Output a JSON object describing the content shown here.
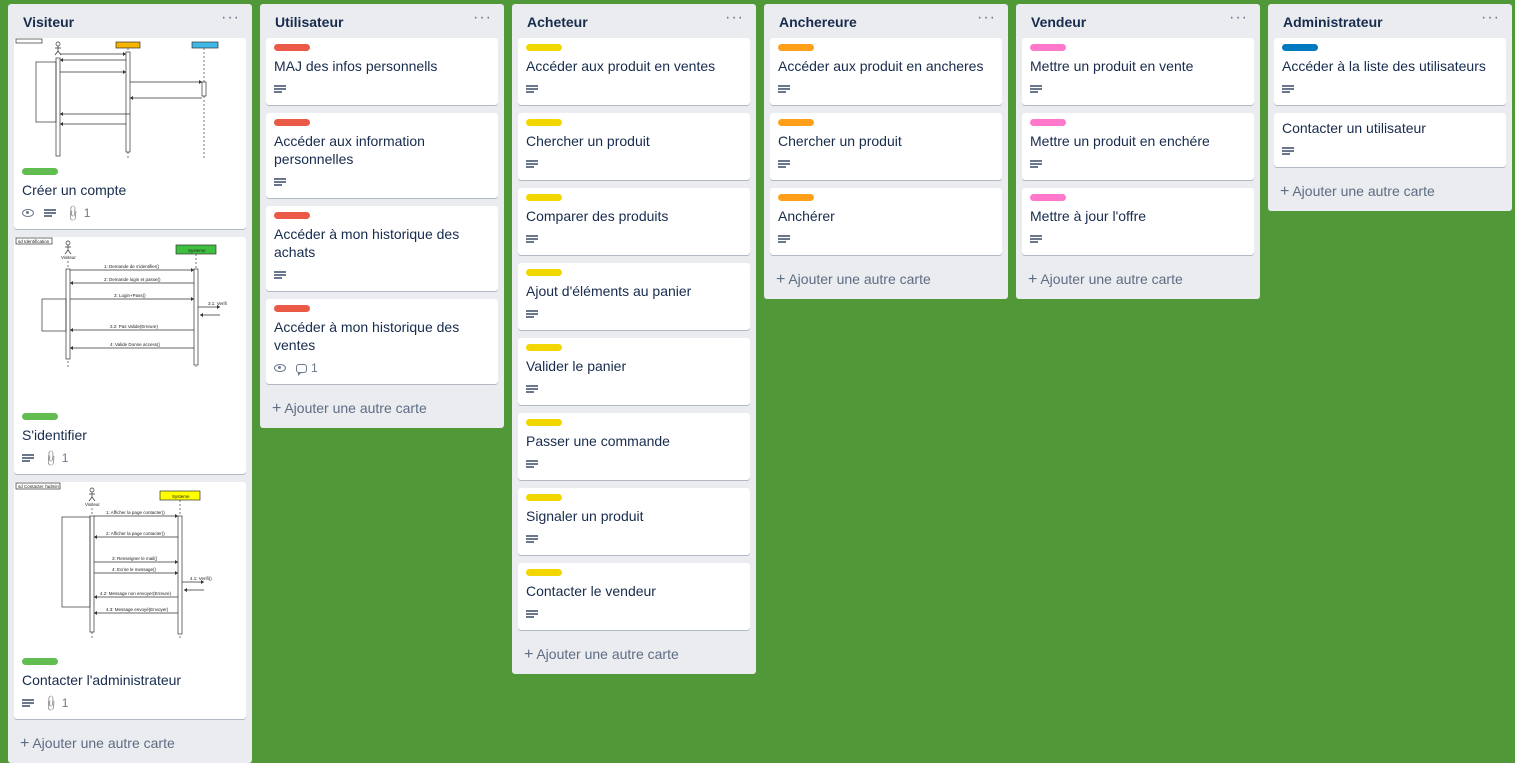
{
  "colors": {
    "board_bg": "#519839",
    "label_green": "#61bd4f",
    "label_red": "#eb5a46",
    "label_yellow": "#f2d600",
    "label_orange": "#ff9f1a",
    "label_pink": "#ff78cb",
    "label_blue": "#0079bf"
  },
  "add_card_label": "Ajouter une autre carte",
  "menu_glyph": "···",
  "lists": [
    {
      "title": "Visiteur",
      "cards": [
        {
          "label_color": "#61bd4f",
          "title": "Créer un compte",
          "icons": [
            "eye-icon",
            "description-icon",
            "attachment-icon"
          ],
          "attachments": "1",
          "cover": "sequence-diagram-inscription"
        },
        {
          "label_color": "#61bd4f",
          "title": "S'identifier",
          "icons": [
            "description-icon",
            "attachment-icon"
          ],
          "attachments": "1",
          "cover": "sequence-diagram-identification",
          "cover_caption": "sd Identification",
          "cover_actor": "Visiteur",
          "cover_system": "Systeme",
          "cover_messages": [
            "1: Demande de s'identifier()",
            "2: Demande login et passe()",
            "3: Login+Pass()",
            "3.1: Verifi",
            "3.2: Pas Valide(Erreure)",
            "4: Valide Donne access()"
          ]
        },
        {
          "label_color": "#61bd4f",
          "title": "Contacter l'administrateur",
          "icons": [
            "description-icon",
            "attachment-icon"
          ],
          "attachments": "1",
          "cover": "sequence-diagram-contact",
          "cover_caption": "sd Contacter l'admin",
          "cover_actor": "Visiteur",
          "cover_system": "Systeme",
          "cover_messages": [
            "1: Afficher la page contacter()",
            "2: Afficher la page contacter()",
            "3: Renseigner le mail()",
            "4: Ecrire le message()",
            "4.1: Verifi()",
            "4.2: Message non envoyer(Erreure)",
            "4.3: Message envoyé(Envoyer)"
          ]
        }
      ]
    },
    {
      "title": "Utilisateur",
      "cards": [
        {
          "label_color": "#eb5a46",
          "title": "MAJ des infos personnells"
        },
        {
          "label_color": "#eb5a46",
          "title": "Accéder aux information personnelles"
        },
        {
          "label_color": "#eb5a46",
          "title": "Accéder à mon historique des achats"
        },
        {
          "label_color": "#eb5a46",
          "title": "Accéder à mon historique des ventes",
          "comments": "1"
        }
      ]
    },
    {
      "title": "Acheteur",
      "cards": [
        {
          "label_color": "#f2d600",
          "title": "Accéder aux produit en ventes"
        },
        {
          "label_color": "#f2d600",
          "title": "Chercher un produit"
        },
        {
          "label_color": "#f2d600",
          "title": "Comparer des produits"
        },
        {
          "label_color": "#f2d600",
          "title": "Ajout d'éléments au panier"
        },
        {
          "label_color": "#f2d600",
          "title": "Valider le panier"
        },
        {
          "label_color": "#f2d600",
          "title": "Passer une commande"
        },
        {
          "label_color": "#f2d600",
          "title": "Signaler un produit"
        },
        {
          "label_color": "#f2d600",
          "title": "Contacter le vendeur"
        }
      ]
    },
    {
      "title": "Anchereure",
      "cards": [
        {
          "label_color": "#ff9f1a",
          "title": "Accéder aux produit en ancheres"
        },
        {
          "label_color": "#ff9f1a",
          "title": "Chercher un produit"
        },
        {
          "label_color": "#ff9f1a",
          "title": "Anchérer"
        }
      ]
    },
    {
      "title": "Vendeur",
      "cards": [
        {
          "label_color": "#ff78cb",
          "title": "Mettre un produit en vente"
        },
        {
          "label_color": "#ff78cb",
          "title": "Mettre un produit en enchére"
        },
        {
          "label_color": "#ff78cb",
          "title": "Mettre à jour l'offre"
        }
      ]
    },
    {
      "title": "Administrateur",
      "cards": [
        {
          "label_color": "#0079bf",
          "title": "Accéder à la liste des utilisateurs"
        },
        {
          "title": "Contacter un utilisateur"
        }
      ]
    }
  ]
}
